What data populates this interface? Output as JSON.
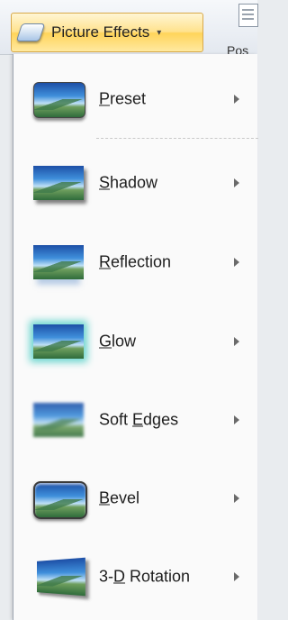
{
  "ribbon": {
    "picture_effects_label": "Picture Effects",
    "dropdown_caret": "▾",
    "position_label": "Pos"
  },
  "menu": {
    "items": [
      {
        "pre": "",
        "mnemonic": "P",
        "post": "reset",
        "thumb": "preset"
      },
      {
        "pre": "",
        "mnemonic": "S",
        "post": "hadow",
        "thumb": "shadow"
      },
      {
        "pre": "",
        "mnemonic": "R",
        "post": "eflection",
        "thumb": "reflection"
      },
      {
        "pre": "",
        "mnemonic": "G",
        "post": "low",
        "thumb": "glow"
      },
      {
        "pre": "Soft ",
        "mnemonic": "E",
        "post": "dges",
        "thumb": "soft-edges"
      },
      {
        "pre": "",
        "mnemonic": "B",
        "post": "evel",
        "thumb": "bevel"
      },
      {
        "pre": "3-",
        "mnemonic": "D",
        "post": " Rotation",
        "thumb": "3-d-rotation"
      }
    ]
  },
  "colors": {
    "button_highlight": "#ffd45a",
    "menu_background": "#fafafa",
    "glow_accent": "#6cd6cf"
  }
}
